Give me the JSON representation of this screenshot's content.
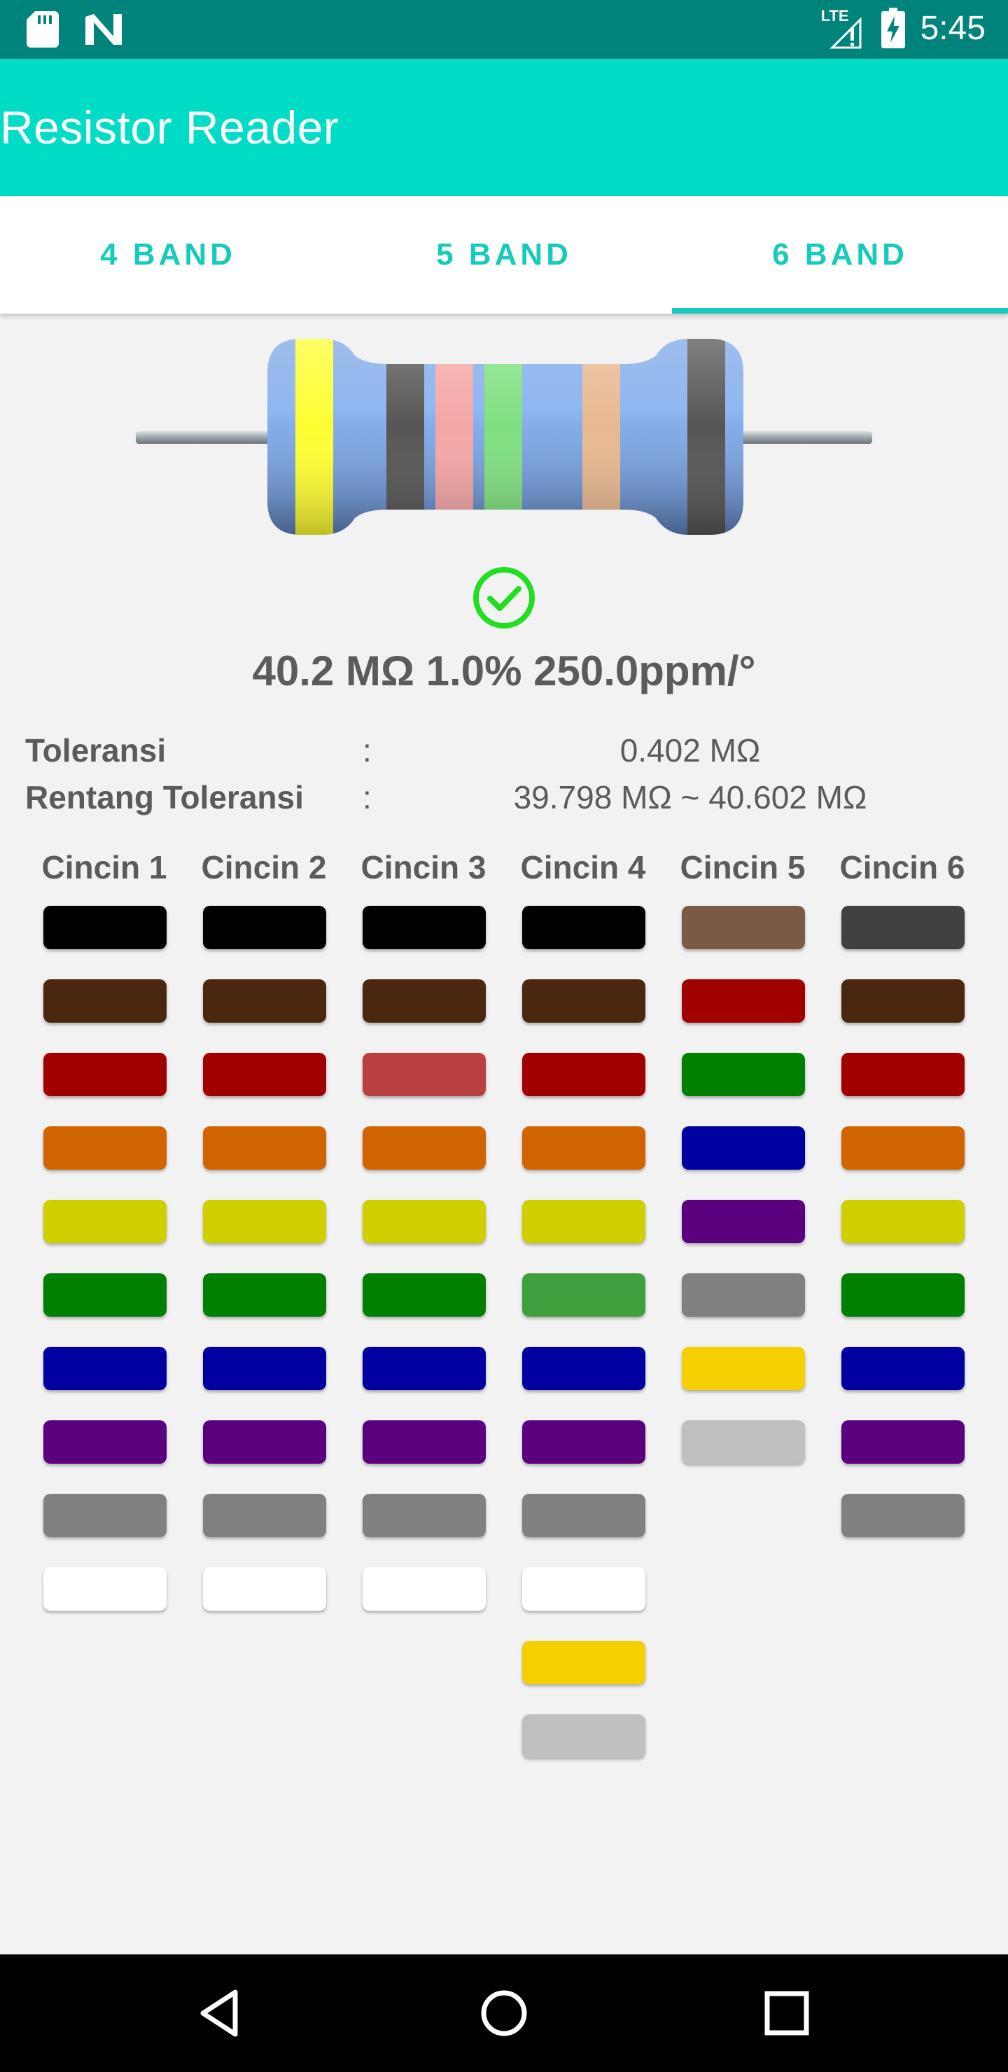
{
  "status_bar": {
    "time": "5:45",
    "network_label": "LTE",
    "icons": [
      "sd-card-icon",
      "n-icon",
      "signal-icon",
      "battery-icon"
    ]
  },
  "app": {
    "title": "Resistor Reader",
    "accent": "#00dcc5"
  },
  "tabs": [
    {
      "label": "4 BAND",
      "selected": false
    },
    {
      "label": "5 BAND",
      "selected": false
    },
    {
      "label": "6 BAND",
      "selected": true
    }
  ],
  "resistor": {
    "bands": [
      "#ffff33",
      "#555555",
      "#f4a6a6",
      "#7fe07f",
      "#e8b891",
      "#555555"
    ]
  },
  "result": {
    "text": "40.2 MΩ 1.0% 250.0ppm/°",
    "valid": true
  },
  "info": [
    {
      "label": "Toleransi",
      "separator": ":",
      "value": "0.402 MΩ"
    },
    {
      "label": "Rentang Toleransi",
      "separator": ":",
      "value": "39.798 MΩ ~ 40.602 MΩ"
    }
  ],
  "columns": [
    {
      "header": "Cincin 1",
      "colors": [
        "#000000",
        "#4a2810",
        "#a10000",
        "#d06400",
        "#d0d000",
        "#007f00",
        "#0000a1",
        "#5a007f",
        "#808080",
        "#ffffff"
      ]
    },
    {
      "header": "Cincin 2",
      "colors": [
        "#000000",
        "#4a2810",
        "#a10000",
        "#d06400",
        "#d0d000",
        "#007f00",
        "#0000a1",
        "#5a007f",
        "#808080",
        "#ffffff"
      ]
    },
    {
      "header": "Cincin 3",
      "colors": [
        "#000000",
        "#4a2810",
        "#b84040",
        "#d06400",
        "#d0d000",
        "#007f00",
        "#0000a1",
        "#5a007f",
        "#808080",
        "#ffffff"
      ]
    },
    {
      "header": "Cincin 4",
      "colors": [
        "#000000",
        "#4a2810",
        "#a10000",
        "#d06400",
        "#d0d000",
        "#40a040",
        "#0000a1",
        "#5a007f",
        "#808080",
        "#ffffff",
        "#f5d000",
        "#c0c0c0"
      ]
    },
    {
      "header": "Cincin 5",
      "colors": [
        "#7a5a45",
        "#a10000",
        "#007f00",
        "#0000a1",
        "#5a007f",
        "#808080",
        "#f5d000",
        "#c0c0c0"
      ]
    },
    {
      "header": "Cincin 6",
      "colors": [
        "#404040",
        "#4a2810",
        "#a10000",
        "#d06400",
        "#d0d000",
        "#007f00",
        "#0000a1",
        "#5a007f",
        "#808080"
      ]
    }
  ],
  "nav": [
    "back-icon",
    "home-icon",
    "recents-icon"
  ]
}
